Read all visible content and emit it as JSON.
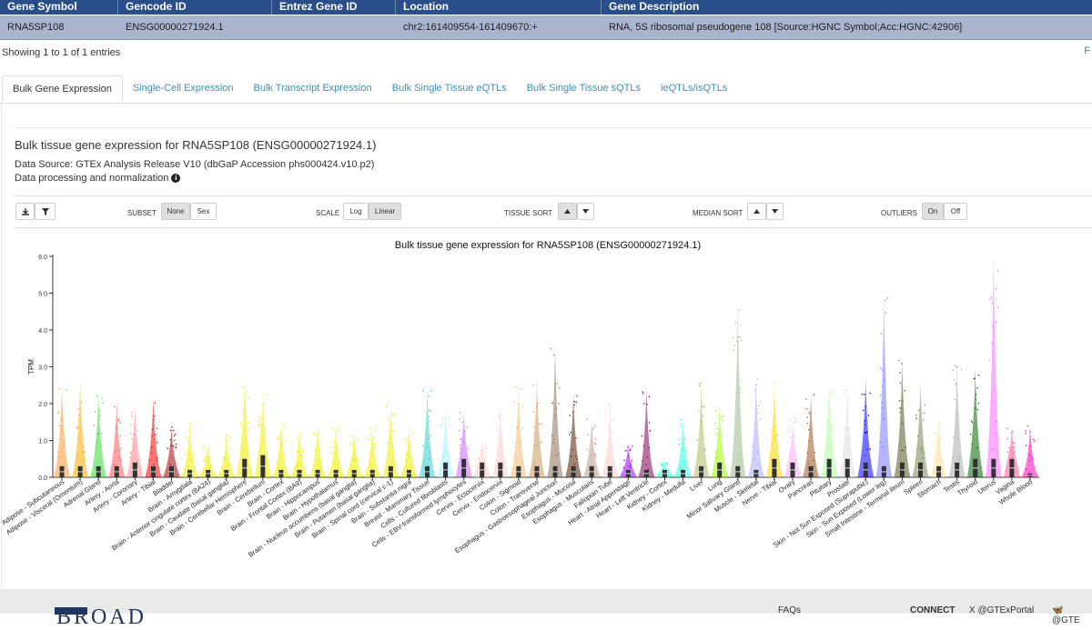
{
  "table": {
    "headers": [
      "Gene Symbol",
      "Gencode ID",
      "Entrez Gene ID",
      "Location",
      "Gene Description"
    ],
    "row": [
      "RNA5SP108",
      "ENSG00000271924.1",
      "",
      "chr2:161409554-161409670:+",
      "RNA, 5S ribosomal pseudogene 108 [Source:HGNC Symbol;Acc:HGNC:42906]"
    ]
  },
  "entries_text": "Showing 1 to 1 of 1 entries",
  "right_mark": "F",
  "tabs": [
    "Bulk Gene Expression",
    "Single-Cell Expression",
    "Bulk Transcript Expression",
    "Bulk Single Tissue eQTLs",
    "Bulk Single Tissue sQTLs",
    "ieQTLs/isQTLs"
  ],
  "active_tab": "Bulk Gene Expression",
  "section_title": "Bulk tissue gene expression for RNA5SP108 (ENSG00000271924.1)",
  "data_source": "Data Source: GTEx Analysis Release V10 (dbGaP Accession phs000424.v10.p2)",
  "data_processing": "Data processing and normalization",
  "toolbar": {
    "subset_label": "SUBSET",
    "subset_none": "None",
    "subset_sex": "Sex",
    "scale_label": "SCALE",
    "scale_log": "Log",
    "scale_linear": "Linear",
    "tissue_sort_label": "TISSUE SORT",
    "median_sort_label": "MEDIAN SORT",
    "outliers_label": "OUTLIERS",
    "outliers_on": "On",
    "outliers_off": "Off",
    "download_icon": "download-icon",
    "filter_icon": "filter-icon"
  },
  "chart_data": {
    "type": "violin",
    "title": "Bulk tissue gene expression for RNA5SP108 (ENSG00000271924.1)",
    "ylabel": "TPM",
    "ylim": [
      0,
      6.0
    ],
    "yticks": [
      "0.0",
      "1.0",
      "2.0",
      "3.0",
      "4.0",
      "5.0",
      "6.0"
    ],
    "categories": [
      "Adipose - Subcutaneous",
      "Adipose - Visceral (Omentum)",
      "Adrenal Gland",
      "Artery - Aorta",
      "Artery - Coronary",
      "Artery - Tibial",
      "Bladder",
      "Brain - Amygdala",
      "Brain - Anterior cingulate cortex (BA24)",
      "Brain - Caudate (basal ganglia)",
      "Brain - Cerebellar Hemisphere",
      "Brain - Cerebellum",
      "Brain - Cortex",
      "Brain - Frontal Cortex (BA9)",
      "Brain - Hippocampus",
      "Brain - Hypothalamus",
      "Brain - Nucleus accumbens (basal ganglia)",
      "Brain - Putamen (basal ganglia)",
      "Brain - Spinal cord (cervical c-1)",
      "Brain - Substantia nigra",
      "Breast - Mammary Tissue",
      "Cells - Cultured fibroblasts",
      "Cells - EBV-transformed lymphocytes",
      "Cervix - Ectocervix",
      "Cervix - Endocervix",
      "Colon - Sigmoid",
      "Colon - Transverse",
      "Esophagus - Gastroesophageal Junction",
      "Esophagus - Mucosa",
      "Esophagus - Muscularis",
      "Fallopian Tube",
      "Heart - Atrial Appendage",
      "Heart - Left Ventricle",
      "Kidney - Cortex",
      "Kidney - Medulla",
      "Liver",
      "Lung",
      "Minor Salivary Gland",
      "Muscle - Skeletal",
      "Nerve - Tibial",
      "Ovary",
      "Pancreas",
      "Pituitary",
      "Prostate",
      "Skin - Not Sun Exposed (Suprapubic)",
      "Skin - Sun Exposed (Lower leg)",
      "Small Intestine - Terminal Ileum",
      "Spleen",
      "Stomach",
      "Testis",
      "Thyroid",
      "Uterus",
      "Vagina",
      "Whole Blood"
    ],
    "colors": [
      "#ff9933",
      "#ffaa00",
      "#33dd33",
      "#ff5555",
      "#ff8888",
      "#ff0000",
      "#aa0000",
      "#eeee00",
      "#eeee00",
      "#eeee00",
      "#eeee00",
      "#eeee00",
      "#eeee00",
      "#eeee00",
      "#eeee00",
      "#eeee00",
      "#eeee00",
      "#eeee00",
      "#eeee00",
      "#eeee00",
      "#33cccc",
      "#aaeeff",
      "#cc66ff",
      "#ffcccc",
      "#ffcccc",
      "#eebb77",
      "#cc9955",
      "#8b7355",
      "#552200",
      "#bb9988",
      "#ffcccc",
      "#9900ff",
      "#7f0055",
      "#22ffdd",
      "#22ffdd",
      "#aabb66",
      "#99ff00",
      "#99bb88",
      "#aaaaff",
      "#ffd700",
      "#ffaaff",
      "#995522",
      "#aaff99",
      "#dddddd",
      "#0000ff",
      "#7777ff",
      "#555522",
      "#778855",
      "#ffdd99",
      "#aaaaaa",
      "#006600",
      "#ff66ff",
      "#ff5599",
      "#ff00bb"
    ],
    "medians": [
      0.3,
      0.3,
      0.3,
      0.3,
      0.4,
      0.3,
      0.3,
      0.2,
      0.2,
      0.2,
      0.5,
      0.6,
      0.2,
      0.2,
      0.2,
      0.2,
      0.2,
      0.2,
      0.3,
      0.2,
      0.3,
      0.4,
      0.5,
      0.4,
      0.4,
      0.3,
      0.3,
      0.3,
      0.3,
      0.3,
      0.3,
      0.2,
      0.2,
      0.2,
      0.2,
      0.3,
      0.4,
      0.3,
      0.2,
      0.5,
      0.4,
      0.3,
      0.5,
      0.5,
      0.4,
      0.3,
      0.4,
      0.4,
      0.3,
      0.4,
      0.5,
      0.5,
      0.5,
      0.1
    ],
    "maxes": [
      2.5,
      2.6,
      2.3,
      2.1,
      2.0,
      2.2,
      1.4,
      1.5,
      0.9,
      1.2,
      2.7,
      2.3,
      1.6,
      1.3,
      1.5,
      1.4,
      1.3,
      1.4,
      2.0,
      1.4,
      2.4,
      1.9,
      1.8,
      1.0,
      1.9,
      2.5,
      2.7,
      3.6,
      2.3,
      1.6,
      2.0,
      0.9,
      2.4,
      0.4,
      1.6,
      2.6,
      2.0,
      4.7,
      2.7,
      2.6,
      1.6,
      2.3,
      2.6,
      2.5,
      2.7,
      4.9,
      3.2,
      2.6,
      1.7,
      3.1,
      3.0,
      6.1,
      1.4,
      1.4
    ]
  },
  "footer": {
    "faqs": "FAQs",
    "connect": "CONNECT",
    "x_handle": "X @GTExPortal",
    "bsky_handle": "@GTE",
    "broad_logo_text": "BROAD"
  }
}
